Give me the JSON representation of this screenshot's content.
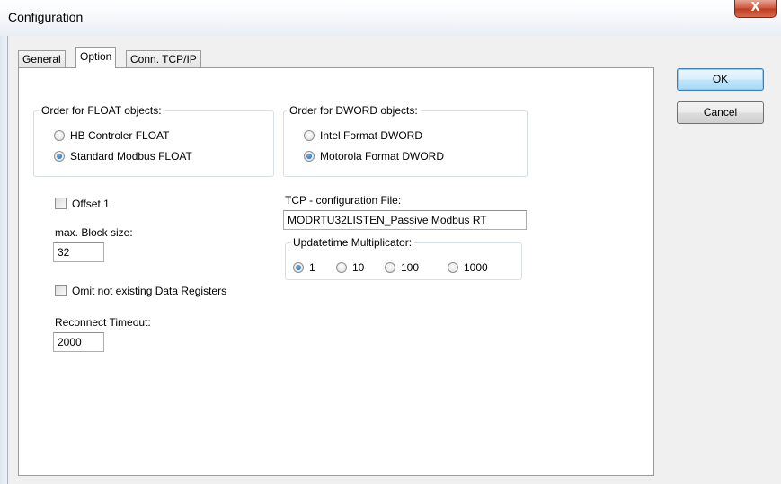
{
  "window": {
    "title": "Configuration",
    "close_glyph": "X"
  },
  "tabs": [
    "General",
    "Option",
    "Conn. TCP/IP"
  ],
  "buttons": {
    "ok": "OK",
    "cancel": "Cancel"
  },
  "float_group": {
    "title": "Order for FLOAT objects:",
    "options": [
      {
        "label": "HB Controler FLOAT",
        "checked": false
      },
      {
        "label": "Standard Modbus FLOAT",
        "checked": true
      }
    ]
  },
  "dword_group": {
    "title": "Order for DWORD objects:",
    "options": [
      {
        "label": "Intel Format DWORD",
        "checked": false
      },
      {
        "label": "Motorola Format DWORD",
        "checked": true
      }
    ]
  },
  "offset": {
    "label": "Offset 1",
    "checked": false
  },
  "block_size": {
    "label": "max. Block size:",
    "value": "32"
  },
  "omit": {
    "label": "Omit not existing Data Registers",
    "checked": false
  },
  "reconnect": {
    "label": "Reconnect Timeout:",
    "value": "2000"
  },
  "tcp_file": {
    "label": "TCP - configuration File:",
    "value": "MODRTU32LISTEN_Passive Modbus RT"
  },
  "update_group": {
    "title": "Updatetime Multiplicator:",
    "options": [
      {
        "label": "1",
        "checked": true
      },
      {
        "label": "10",
        "checked": false
      },
      {
        "label": "100",
        "checked": false
      },
      {
        "label": "1000",
        "checked": false
      }
    ]
  }
}
